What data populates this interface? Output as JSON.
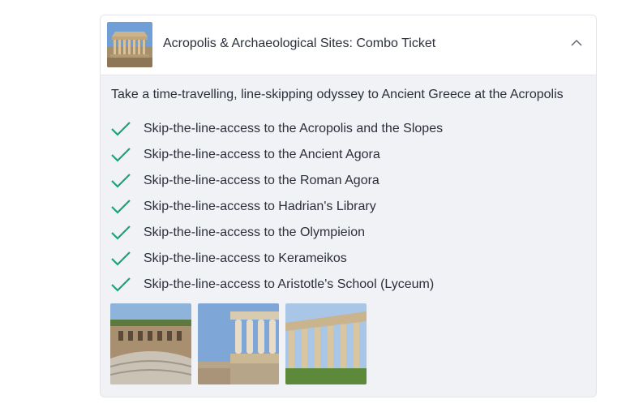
{
  "header": {
    "title": "Acropolis & Archaeological Sites: Combo Ticket",
    "thumbnail_icon": "parthenon-thumbnail",
    "collapse_icon": "chevron-up-icon"
  },
  "body": {
    "intro": "Take a time-travelling, line-skipping odyssey to Ancient Greece at the Acropolis",
    "features": [
      "Skip-the-line-access to the Acropolis and the Slopes",
      "Skip-the-line-access to the Ancient Agora",
      "Skip-the-line-access to the Roman Agora",
      "Skip-the-line-access to Hadrian's Library",
      "Skip-the-line-access to the Olympieion",
      "Skip-the-line-access to Kerameikos",
      "Skip-the-line-access to Aristotle's School (Lyceum)"
    ],
    "gallery": [
      "odeon-photo",
      "caryatids-photo",
      "temple-columns-photo"
    ]
  },
  "colors": {
    "check": "#1aa37a",
    "text": "#2a2f3a",
    "panel_bg": "#f1f2f6",
    "border": "#e3e5ea"
  }
}
